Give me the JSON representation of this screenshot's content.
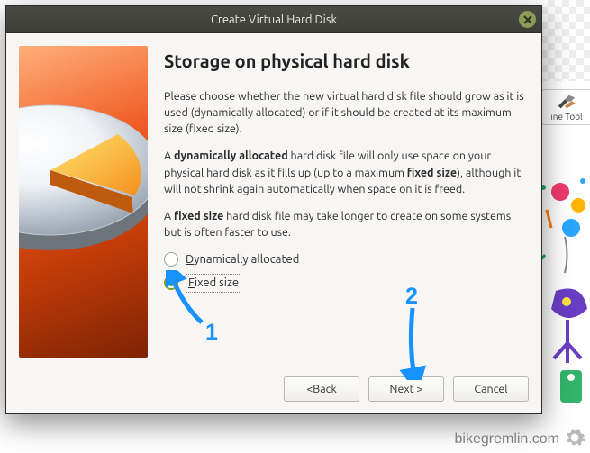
{
  "titlebar": {
    "title": "Create Virtual Hard Disk"
  },
  "toolbar": {
    "item": "ine Tool"
  },
  "page": {
    "heading": "Storage on physical hard disk",
    "intro": "Please choose whether the new virtual hard disk file should grow as it is used (dynamically allocated) or if it should be created at its maximum size (fixed size).",
    "para2_a": "A ",
    "para2_b": "dynamically allocated",
    "para2_c": " hard disk file will only use space on your physical hard disk as it fills up (up to a maximum ",
    "para2_d": "fixed size",
    "para2_e": "), although it will not shrink again automatically when space on it is freed.",
    "para3_a": "A ",
    "para3_b": "fixed size",
    "para3_c": " hard disk file may take longer to create on some systems but is often faster to use.",
    "option_dyn_letter": "D",
    "option_dyn_rest": "ynamically allocated",
    "option_fix_letter": "F",
    "option_fix_rest": "ixed size"
  },
  "buttons": {
    "back_lt": "< ",
    "back_u": "B",
    "back_rest": "ack",
    "next_u": "N",
    "next_rest": "ext >",
    "cancel": "Cancel"
  },
  "annotations": {
    "one": "1",
    "two": "2"
  },
  "watermark": "bikegremlin.com"
}
